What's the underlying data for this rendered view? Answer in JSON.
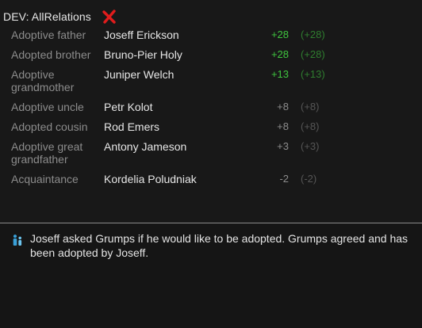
{
  "window": {
    "title": "DEV: AllRelations"
  },
  "colors": {
    "positive": "#3fc43f",
    "positive_muted": "#2f7d2f",
    "neutral": "#8c8c8c",
    "neutral_muted": "#555555"
  },
  "relations": [
    {
      "type": "Adoptive father",
      "name": "Joseff Erickson",
      "value": "+28",
      "base": "(+28)",
      "tone": "positive"
    },
    {
      "type": "Adopted brother",
      "name": "Bruno-Pier Holy",
      "value": "+28",
      "base": "(+28)",
      "tone": "positive"
    },
    {
      "type": "Adoptive grandmother",
      "name": "Juniper Welch",
      "value": "+13",
      "base": "(+13)",
      "tone": "positive"
    },
    {
      "type": "Adoptive uncle",
      "name": "Petr Kolot",
      "value": "+8",
      "base": "(+8)",
      "tone": "neutral"
    },
    {
      "type": "Adopted cousin",
      "name": "Rod Emers",
      "value": "+8",
      "base": "(+8)",
      "tone": "neutral"
    },
    {
      "type": "Adoptive great grandfather",
      "name": "Antony Jameson",
      "value": "+3",
      "base": "(+3)",
      "tone": "neutral"
    },
    {
      "type": "Acquaintance",
      "name": "Kordelia Poludniak",
      "value": "-2",
      "base": "(-2)",
      "tone": "neutral"
    }
  ],
  "log": {
    "icon": "family-icon",
    "message": "Joseff asked Grumps if he would like to be adopted. Grumps agreed and has been adopted by Joseff."
  }
}
